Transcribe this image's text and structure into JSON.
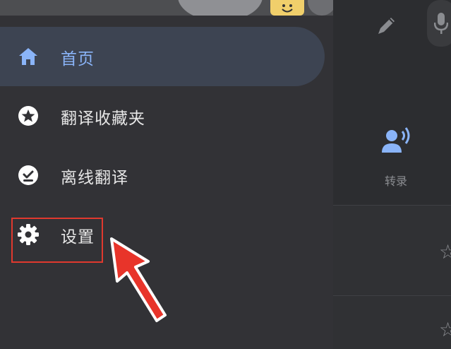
{
  "drawer": {
    "items": [
      {
        "label": "首页",
        "icon": "home-icon",
        "active": true
      },
      {
        "label": "翻译收藏夹",
        "icon": "star-icon",
        "active": false
      },
      {
        "label": "离线翻译",
        "icon": "offline-check-icon",
        "active": false
      },
      {
        "label": "设置",
        "icon": "gear-icon",
        "active": false
      }
    ]
  },
  "background": {
    "transcribe_label": "转录",
    "icons": [
      "pen-icon",
      "mic-icon",
      "transcribe-icon",
      "star-icon"
    ]
  },
  "colors": {
    "drawer_bg": "#323236",
    "active_item_bg": "#3d4452",
    "active_accent": "#8ab4f8",
    "highlight_red": "#e0392e"
  }
}
